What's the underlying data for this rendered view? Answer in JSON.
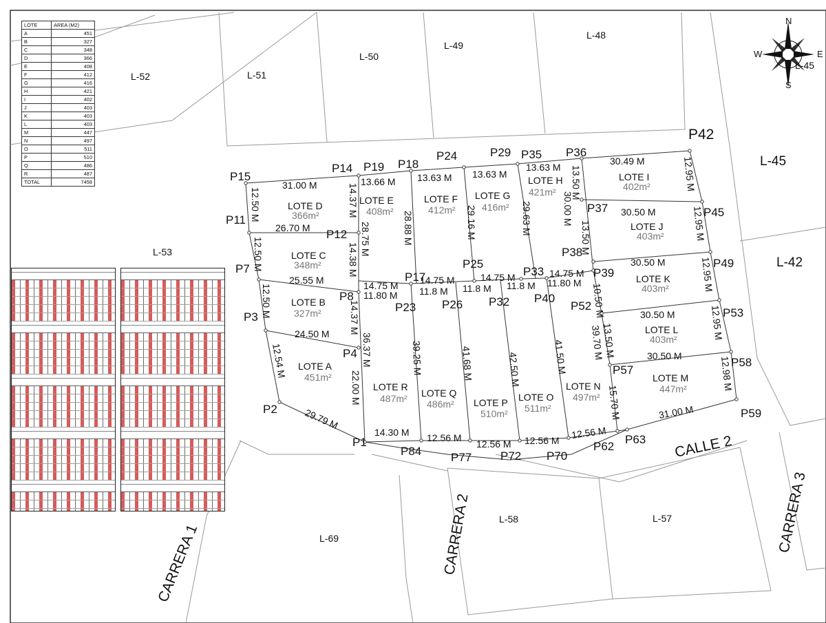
{
  "area_table": {
    "headers": [
      "LOTE",
      "AREA (M2)"
    ],
    "rows": [
      [
        "A",
        "451"
      ],
      [
        "B",
        "327"
      ],
      [
        "C",
        "348"
      ],
      [
        "D",
        "366"
      ],
      [
        "E",
        "408"
      ],
      [
        "F",
        "412"
      ],
      [
        "G",
        "416"
      ],
      [
        "H",
        "421"
      ],
      [
        "I",
        "402"
      ],
      [
        "J",
        "403"
      ],
      [
        "K",
        "403"
      ],
      [
        "L",
        "403"
      ],
      [
        "M",
        "447"
      ],
      [
        "N",
        "497"
      ],
      [
        "O",
        "511"
      ],
      [
        "P",
        "510"
      ],
      [
        "Q",
        "486"
      ],
      [
        "R",
        "487"
      ]
    ],
    "total": [
      "TOTAL",
      "7458"
    ]
  },
  "compass": {
    "n": "N",
    "s": "S",
    "e": "E",
    "w": "W"
  },
  "neighbors": {
    "l52": "L-52",
    "l51": "L-51",
    "l50": "L-50",
    "l49": "L-49",
    "l48": "L-48",
    "l45": "L-45",
    "l45b": "L-45",
    "l42": "L-42",
    "l53": "L-53",
    "l58": "L-58",
    "l57": "L-57",
    "l69": "L-69"
  },
  "streets": {
    "calle2": "CALLE 2",
    "carrera1": "CARRERA 1",
    "carrera2": "CARRERA 2",
    "carrera3": "CARRERA 3"
  },
  "lots": {
    "a": {
      "name": "LOTE A",
      "area": "451m²"
    },
    "b": {
      "name": "LOTE B",
      "area": "327m²"
    },
    "c": {
      "name": "LOTE C",
      "area": "348m²"
    },
    "d": {
      "name": "LOTE D",
      "area": "366m²"
    },
    "e": {
      "name": "LOTE E",
      "area": "408m²"
    },
    "f": {
      "name": "LOTE F",
      "area": "412m²"
    },
    "g": {
      "name": "LOTE G",
      "area": "416m²"
    },
    "h": {
      "name": "LOTE H",
      "area": "421m²"
    },
    "i": {
      "name": "LOTE I",
      "area": "402m²"
    },
    "j": {
      "name": "LOTE J",
      "area": "403m²"
    },
    "k": {
      "name": "LOTE K",
      "area": "403m²"
    },
    "l": {
      "name": "LOTE L",
      "area": "403m²"
    },
    "m": {
      "name": "LOTE M",
      "area": "447m²"
    },
    "n": {
      "name": "LOTE N",
      "area": "497m²"
    },
    "o": {
      "name": "LOTE O",
      "area": "511m²"
    },
    "p": {
      "name": "LOTE P",
      "area": "510m²"
    },
    "q": {
      "name": "LOTE Q",
      "area": "486m²"
    },
    "r": {
      "name": "LOTE R",
      "area": "487m²"
    }
  },
  "points": {
    "p1": "P1",
    "p2": "P2",
    "p3": "P3",
    "p4": "P4",
    "p7": "P7",
    "p8": "P8",
    "p11": "P11",
    "p12": "P12",
    "p14": "P14",
    "p15": "P15",
    "p17": "P17",
    "p18": "P18",
    "p19": "P19",
    "p23": "P23",
    "p24": "P24",
    "p25": "P25",
    "p26": "P26",
    "p29": "P29",
    "p32": "P32",
    "p33": "P33",
    "p35": "P35",
    "p36": "P36",
    "p37": "P37",
    "p38": "P38",
    "p39": "P39",
    "p40": "P40",
    "p42": "P42",
    "p45": "P45",
    "p49": "P49",
    "p52": "P52",
    "p53": "P53",
    "p57": "P57",
    "p58": "P58",
    "p59": "P59",
    "p62": "P62",
    "p63": "P63",
    "p70": "P70",
    "p72": "P72",
    "p77": "P77",
    "p84": "P84"
  },
  "dims": {
    "d_p15p14": "31.00 M",
    "d_p15p11": "12.50 M",
    "d_p11p12": "26.70 M",
    "d_p11p7": "12.50 M",
    "d_p7p8": "25.55 M",
    "d_p7p3": "12.50 M",
    "d_p3p4": "24.50 M",
    "d_p3p2": "12.54 M",
    "d_p2p1": "29.79 M",
    "d_p14p12": "14.37 M",
    "d_p12p8": "14.38 M",
    "d_p8p4": "14.37 M",
    "d_p4p1": "22.00 M",
    "d_p19p17": "28.75 M",
    "d_p8p1": "36.37 M",
    "d_p19p18": "13.66 M",
    "d_p18p24": "13.63 M",
    "d_p24p29": "13.63 M",
    "d_p35p36": "13.63 M",
    "d_p36p42": "30.49 M",
    "d_p42p45": "12.95 M",
    "d_p18p17": "28.88 M",
    "d_p24p25": "29.16 M",
    "d_p29p33": "29.63 M",
    "d_p36p37a": "30.00 M",
    "d_p36p37b": "13.50 M",
    "d_p37p38": "13.50 M",
    "d_p37p45": "30.50 M",
    "d_p45p49": "12.95 M",
    "d_p38p49": "30.50 M",
    "d_p49p53": "12.95 M",
    "d_p52p53": "30.50 M",
    "d_p53p58": "12.95 M",
    "d_p57p58": "30.50 M",
    "d_p58p59": "12.98 M",
    "d_p63p59": "31.00 M",
    "d_p8p17": "14.75 M",
    "d_p17p25": "14.75 M",
    "d_p25p33": "14.75 M",
    "d_p33p39": "14.75 M",
    "d_p8p23": "11.80 M",
    "d_p23p26": "11.8 M",
    "d_p26p32": "11.8 M",
    "d_p32p40": "11.8 M",
    "d_p40p39": "11.80 M",
    "d_p39p52": "10.50 M",
    "d_p52p57a": "13.50 M",
    "d_p52p57b": "39.70 M",
    "d_p57p62": "15.70 M",
    "d_p23p84": "39.25 M",
    "d_p26p77": "41.68 M",
    "d_p32p72": "42.50 M",
    "d_p40p70": "41.50 M",
    "d_p1p84": "14.30 M",
    "d_p84p77": "12.56 M",
    "d_p77p72": "12.56 M",
    "d_p72p70": "12.56 M",
    "d_p70p62": "12.56 M"
  }
}
